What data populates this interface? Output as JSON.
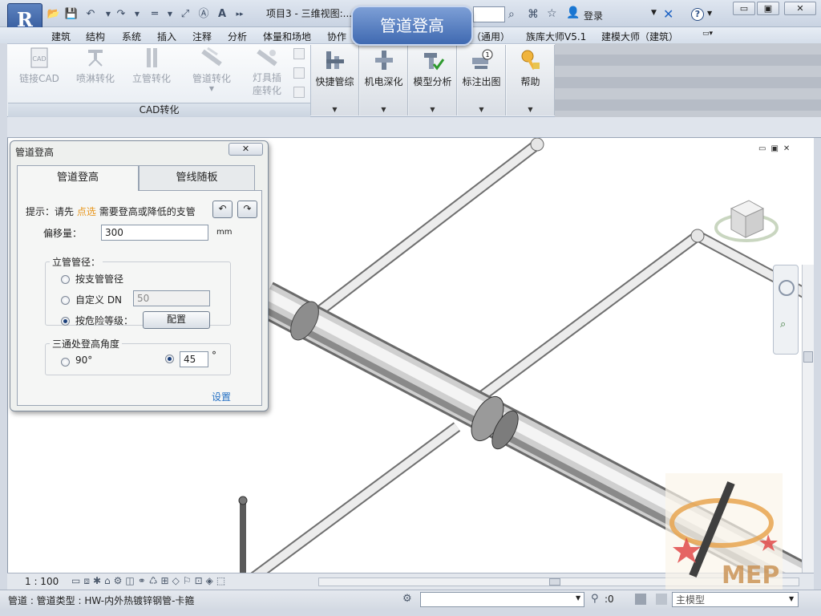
{
  "window": {
    "title": "项目3 - 三维视图:...",
    "login_label": "登录",
    "help_label": "?",
    "win_controls": [
      "▭",
      "▣",
      "✕"
    ]
  },
  "menu": [
    "建筑",
    "结构",
    "系统",
    "插入",
    "注释",
    "分析",
    "体量和场地",
    "协作",
    "（通用）",
    "族库大师V5.1",
    "建模大师（建筑）"
  ],
  "ribbon": {
    "cad_tools": [
      {
        "label": "链接CAD",
        "icon": "link-cad-icon"
      },
      {
        "label": "喷淋转化",
        "icon": "sprinkler-icon"
      },
      {
        "label": "立管转化",
        "icon": "riser-icon"
      },
      {
        "label": "管道转化",
        "icon": "pipe-convert-icon"
      },
      {
        "label": "灯具插座转化",
        "label_line1": "灯具插",
        "label_line2": "座转化",
        "icon": "lamp-icon"
      }
    ],
    "cad_panel_label": "CAD转化",
    "tools": [
      {
        "label": "快捷管综",
        "icon": "quick-pipe-icon"
      },
      {
        "label": "机电深化",
        "icon": "mep-deepen-icon"
      },
      {
        "label": "模型分析",
        "icon": "model-analysis-icon"
      },
      {
        "label": "标注出图",
        "icon": "annotate-icon"
      },
      {
        "label": "帮助",
        "icon": "help-key-icon"
      }
    ]
  },
  "banner_label": "管道登高",
  "dialog": {
    "title": "管道登高",
    "close_label": "✕",
    "tabs": [
      "管道登高",
      "管线随板"
    ],
    "hint_prefix": "提示：请先",
    "hint_action": "点选",
    "hint_suffix": "需要登高或降低的支管",
    "offset_label": "偏移量：",
    "offset_value": "300",
    "offset_unit": "mm",
    "riser_group_title": "立管管径：",
    "riser_options": [
      {
        "label": "按支管管径",
        "checked": false
      },
      {
        "label": "自定义 DN",
        "checked": false
      },
      {
        "label": "按危险等级：",
        "checked": true
      }
    ],
    "custom_dn_value": "50",
    "config_button": "配置",
    "tee_group_title": "三通处登高角度",
    "angle_options": [
      {
        "label": "90°",
        "checked": false
      },
      {
        "label": "",
        "checked": true
      }
    ],
    "angle_value": "45",
    "angle_unit": "°",
    "settings_link": "设置"
  },
  "status": {
    "scale": "1 : 100",
    "element_info": "管道 : 管道类型 : HW-内外热镀锌钢管-卡箍",
    "filter_count": ":0",
    "model_label": "主模型"
  },
  "watermark_text": "MEP",
  "colors": {
    "accent": "#2470c4",
    "hint_highlight": "#e8961c",
    "banner": "#4f77bb"
  }
}
